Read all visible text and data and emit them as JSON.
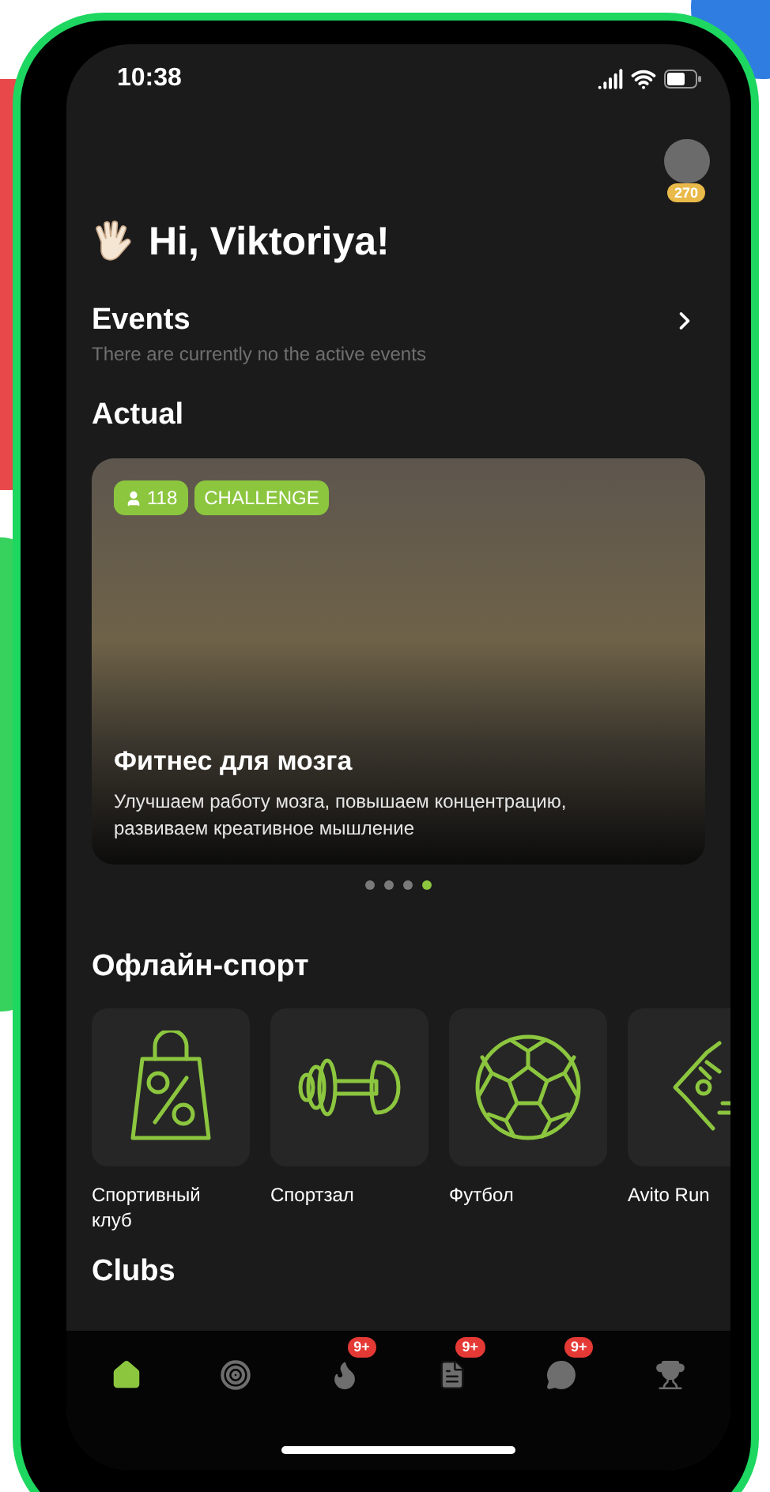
{
  "status_bar": {
    "time": "10:38"
  },
  "profile": {
    "points": "270"
  },
  "greeting": "Hi, Viktoriya!",
  "events": {
    "title": "Events",
    "subtitle": "There are currently no the active events"
  },
  "actual": {
    "title": "Actual",
    "card": {
      "participants": "118",
      "tag": "CHALLENGE",
      "title": "Фитнес для мозга",
      "description": "Улучшаем работу мозга, повышаем концентрацию, развиваем креативное мышление"
    },
    "dots": [
      {
        "selected": false
      },
      {
        "selected": false
      },
      {
        "selected": false
      },
      {
        "selected": true
      }
    ]
  },
  "offline_sport": {
    "title": "Офлайн-спорт",
    "items": [
      {
        "kind": "bag",
        "label": "Спортивный клуб"
      },
      {
        "kind": "dumbbell",
        "label": "Спортзал"
      },
      {
        "kind": "ball",
        "label": "Футбол"
      },
      {
        "kind": "sneaker",
        "label": "Avito Run"
      }
    ]
  },
  "clubs": {
    "title": "Clubs"
  },
  "tab_bar": [
    {
      "kind": "home",
      "selected": true
    },
    {
      "kind": "target",
      "selected": false
    },
    {
      "kind": "flame",
      "selected": false,
      "badge": "9+"
    },
    {
      "kind": "document",
      "selected": false,
      "badge": "9+"
    },
    {
      "kind": "chat",
      "selected": false,
      "badge": "9+"
    },
    {
      "kind": "trophy",
      "selected": false
    }
  ]
}
